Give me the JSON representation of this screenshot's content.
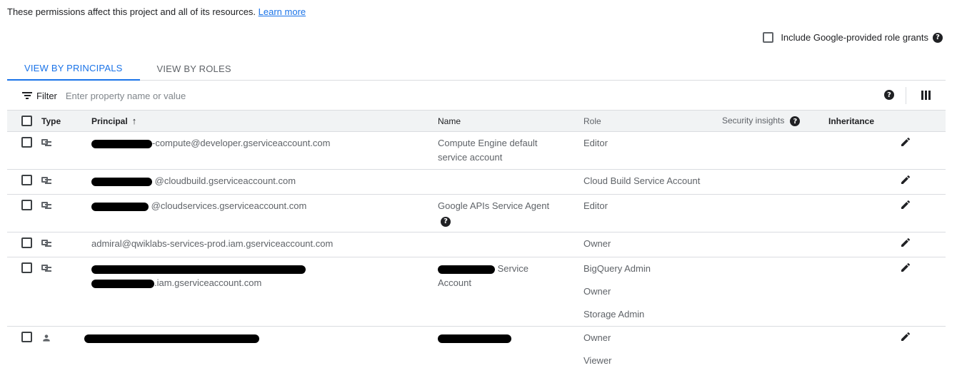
{
  "intro": {
    "text": "These permissions affect this project and all of its resources.",
    "link": "Learn more"
  },
  "grants_label": "Include Google-provided role grants",
  "tabs": [
    {
      "label": "VIEW BY PRINCIPALS",
      "active": true
    },
    {
      "label": "VIEW BY ROLES",
      "active": false
    }
  ],
  "filter": {
    "label": "Filter",
    "placeholder": "Enter property name or value"
  },
  "columns": {
    "type": "Type",
    "principal": "Principal",
    "name": "Name",
    "role": "Role",
    "security": "Security insights",
    "inheritance": "Inheritance"
  },
  "rows": [
    {
      "type": "service-account-icon",
      "principal": [
        "-compute@developer.gserviceaccount.com"
      ],
      "name": [
        "Compute Engine default",
        "service account"
      ],
      "roles": [
        "Editor"
      ]
    },
    {
      "type": "service-account-icon",
      "principal": [
        "@cloudbuild.gserviceaccount.com"
      ],
      "name": [],
      "roles": [
        "Cloud Build Service Account"
      ]
    },
    {
      "type": "service-account-icon",
      "principal": [
        "@cloudservices.gserviceaccount.com"
      ],
      "name": [
        "Google APIs Service Agent"
      ],
      "roles": [
        "Editor"
      ]
    },
    {
      "type": "service-account-icon",
      "principal": [
        "admiral@qwiklabs-services-prod.iam.gserviceaccount.com"
      ],
      "name": [],
      "roles": [
        "Owner"
      ]
    },
    {
      "type": "service-account-icon",
      "principal": [
        "",
        ".iam.gserviceaccount.com"
      ],
      "name": [
        "Service",
        "Account"
      ],
      "roles": [
        "BigQuery Admin",
        "Owner",
        "Storage Admin"
      ]
    },
    {
      "type": "person-icon",
      "principal": [
        ""
      ],
      "name": [],
      "roles": [
        "Owner",
        "Viewer"
      ]
    }
  ]
}
